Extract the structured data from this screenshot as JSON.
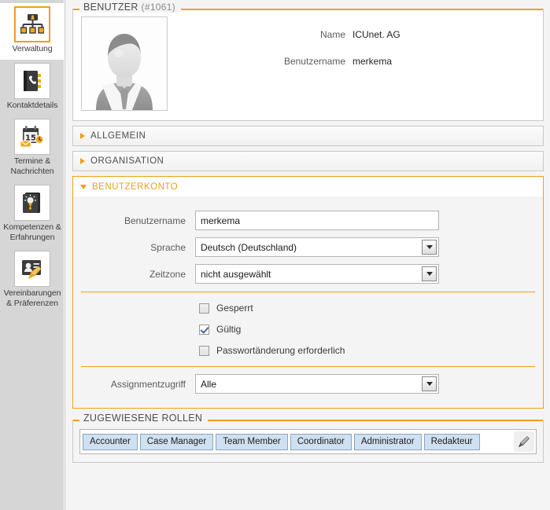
{
  "sidebar": {
    "items": [
      {
        "label": "Verwaltung",
        "icon": "org-chart-icon",
        "active": true
      },
      {
        "label": "Kontaktdetails",
        "icon": "phone-book-icon",
        "active": false
      },
      {
        "label": "Termine & Nachrichten",
        "icon": "calendar-mail-icon",
        "active": false
      },
      {
        "label": "Kompetenzen & Erfahrungen",
        "icon": "book-lightbulb-icon",
        "active": false
      },
      {
        "label": "Vereinbarungen & Präferenzen",
        "icon": "id-card-pencil-icon",
        "active": false
      }
    ]
  },
  "user_panel": {
    "legend_title": "BENUTZER",
    "legend_id": "(#1061)",
    "avatar_alt": "user-avatar",
    "fields": [
      {
        "label": "Name",
        "value": "ICUnet. AG"
      },
      {
        "label": "Benutzername",
        "value": "merkema"
      }
    ]
  },
  "accordion": {
    "allgemein": {
      "label": "ALLGEMEIN",
      "open": false
    },
    "organisation": {
      "label": "ORGANISATION",
      "open": false
    },
    "benutzerkonto": {
      "label": "BENUTZERKONTO",
      "open": true
    }
  },
  "account_form": {
    "username": {
      "label": "Benutzername",
      "value": "merkema"
    },
    "language": {
      "label": "Sprache",
      "value": "Deutsch (Deutschland)"
    },
    "timezone": {
      "label": "Zeitzone",
      "value": "nicht ausgewählt"
    },
    "checkboxes": [
      {
        "label": "Gesperrt",
        "checked": false
      },
      {
        "label": "Gültig",
        "checked": true
      },
      {
        "label": "Passwortänderung erforderlich",
        "checked": false
      }
    ],
    "assignment_access": {
      "label": "Assignmentzugriff",
      "value": "Alle"
    }
  },
  "roles": {
    "legend": "ZUGEWIESENE ROLLEN",
    "tags": [
      "Accounter",
      "Case Manager",
      "Team Member",
      "Coordinator",
      "Administrator",
      "Redakteur"
    ],
    "edit_icon": "pencil-icon"
  },
  "colors": {
    "accent": "#eda11a",
    "sidebar_bg": "#d6d6d6",
    "content_bg": "#f4f4f4",
    "tag_bg": "#cfe0f1"
  }
}
